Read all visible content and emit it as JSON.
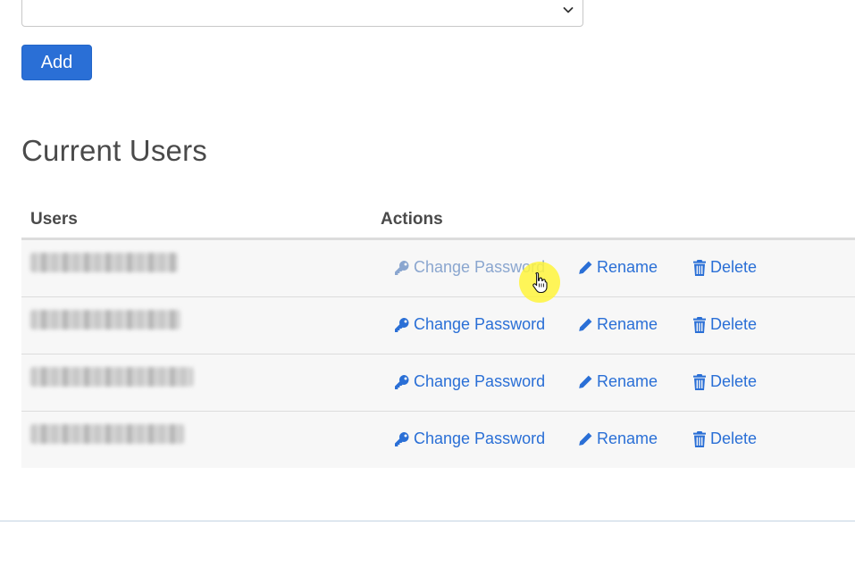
{
  "form": {
    "select_value": "",
    "add_label": "Add"
  },
  "users_section": {
    "title": "Current Users",
    "columns": {
      "users": "Users",
      "actions": "Actions"
    },
    "action_labels": {
      "change_password": "Change Password",
      "rename": "Rename",
      "delete": "Delete"
    },
    "rows": [
      {
        "username_redacted": true
      },
      {
        "username_redacted": true
      },
      {
        "username_redacted": true
      },
      {
        "username_redacted": true
      }
    ]
  },
  "icons": {
    "change_password": "key-icon",
    "rename": "pencil-icon",
    "delete": "trash-icon",
    "select_caret": "chevron-down-icon"
  },
  "colors": {
    "primary": "#2a6fd6",
    "link": "#2a6fd6",
    "link_hover_faded": "#8aa6cf",
    "row_bg": "#f7f7f7",
    "cursor_highlight": "#fff53c"
  }
}
